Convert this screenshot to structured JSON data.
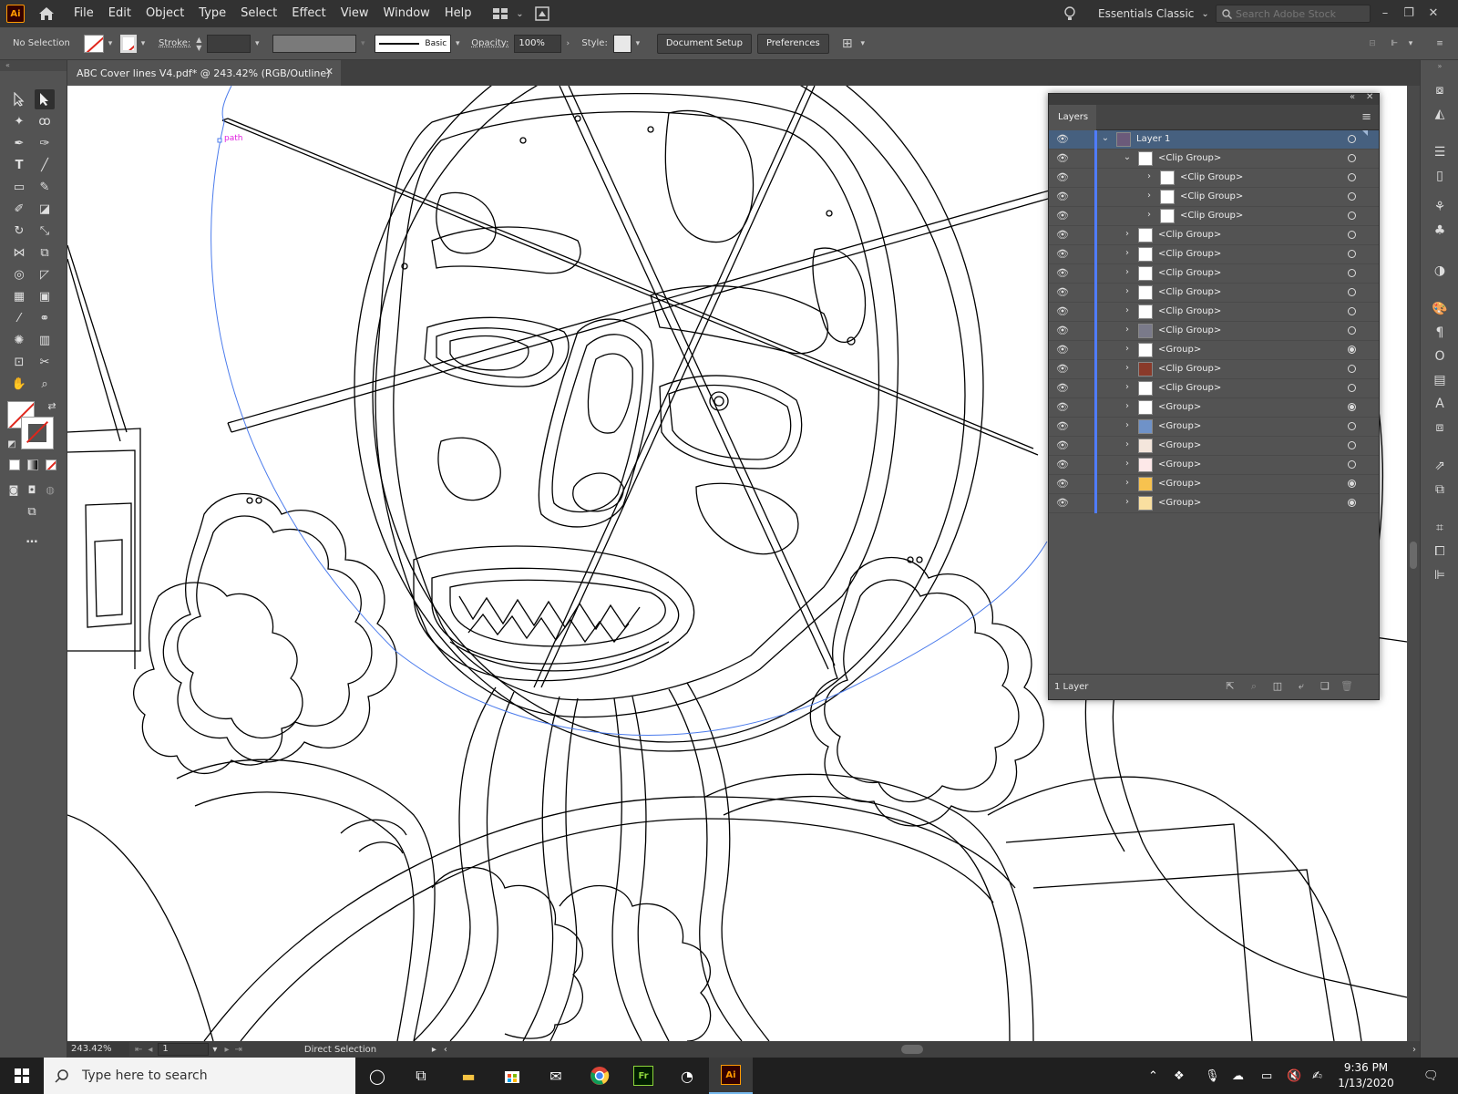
{
  "app": {
    "logo": "Ai"
  },
  "menubar": {
    "items": [
      "File",
      "Edit",
      "Object",
      "Type",
      "Select",
      "Effect",
      "View",
      "Window",
      "Help"
    ],
    "workspace": "Essentials Classic",
    "search_placeholder": "Search Adobe Stock"
  },
  "controlbar": {
    "selection": "No Selection",
    "stroke_label": "Stroke:",
    "brush": "Basic",
    "opacity_label": "Opacity:",
    "opacity_value": "100%",
    "style_label": "Style:",
    "document_setup": "Document Setup",
    "preferences": "Preferences"
  },
  "document": {
    "tab_title": "ABC Cover lines V4.pdf* @ 243.42% (RGB/Outline)",
    "hover_label": "path"
  },
  "statusbar": {
    "zoom": "243.42%",
    "artboard": "1",
    "tool": "Direct Selection"
  },
  "layers_panel": {
    "title": "Layers",
    "footer": "1 Layer",
    "rows": [
      {
        "name": "Layer 1",
        "depth": 0,
        "expanded": true,
        "active": true,
        "thumb": "#6b5a7a",
        "target_filled": false
      },
      {
        "name": "<Clip Group>",
        "depth": 1,
        "expanded": true,
        "active": false,
        "thumb": "#ffffff",
        "target_filled": false
      },
      {
        "name": "<Clip Group>",
        "depth": 2,
        "expanded": false,
        "active": false,
        "thumb": "#ffffff",
        "target_filled": false
      },
      {
        "name": "<Clip Group>",
        "depth": 2,
        "expanded": false,
        "active": false,
        "thumb": "#ffffff",
        "target_filled": false
      },
      {
        "name": "<Clip Group>",
        "depth": 2,
        "expanded": false,
        "active": false,
        "thumb": "#ffffff",
        "target_filled": false
      },
      {
        "name": "<Clip Group>",
        "depth": 1,
        "expanded": false,
        "active": false,
        "thumb": "#ffffff",
        "target_filled": false
      },
      {
        "name": "<Clip Group>",
        "depth": 1,
        "expanded": false,
        "active": false,
        "thumb": "#ffffff",
        "target_filled": false
      },
      {
        "name": "<Clip Group>",
        "depth": 1,
        "expanded": false,
        "active": false,
        "thumb": "#ffffff",
        "target_filled": false
      },
      {
        "name": "<Clip Group>",
        "depth": 1,
        "expanded": false,
        "active": false,
        "thumb": "#ffffff",
        "target_filled": false
      },
      {
        "name": "<Clip Group>",
        "depth": 1,
        "expanded": false,
        "active": false,
        "thumb": "#ffffff",
        "target_filled": false
      },
      {
        "name": "<Clip Group>",
        "depth": 1,
        "expanded": false,
        "active": false,
        "thumb": "#7a7a8a",
        "target_filled": false
      },
      {
        "name": "<Group>",
        "depth": 1,
        "expanded": false,
        "active": false,
        "thumb": "#ffffff",
        "target_filled": true
      },
      {
        "name": "<Clip Group>",
        "depth": 1,
        "expanded": false,
        "active": false,
        "thumb": "#8a3a2a",
        "target_filled": false
      },
      {
        "name": "<Clip Group>",
        "depth": 1,
        "expanded": false,
        "active": false,
        "thumb": "#ffffff",
        "target_filled": false
      },
      {
        "name": "<Group>",
        "depth": 1,
        "expanded": false,
        "active": false,
        "thumb": "#ffffff",
        "target_filled": true
      },
      {
        "name": "<Group>",
        "depth": 1,
        "expanded": false,
        "active": false,
        "thumb": "#6f92c8",
        "target_filled": false
      },
      {
        "name": "<Group>",
        "depth": 1,
        "expanded": false,
        "active": false,
        "thumb": "#f4e6dc",
        "target_filled": false
      },
      {
        "name": "<Group>",
        "depth": 1,
        "expanded": false,
        "active": false,
        "thumb": "#fde8e8",
        "target_filled": false
      },
      {
        "name": "<Group>",
        "depth": 1,
        "expanded": false,
        "active": false,
        "thumb": "#f7c24f",
        "target_filled": true
      },
      {
        "name": "<Group>",
        "depth": 1,
        "expanded": false,
        "active": false,
        "thumb": "#f9dfa0",
        "target_filled": true
      }
    ]
  },
  "taskbar": {
    "search_placeholder": "Type here to search",
    "time": "9:36 PM",
    "date": "1/13/2020"
  }
}
